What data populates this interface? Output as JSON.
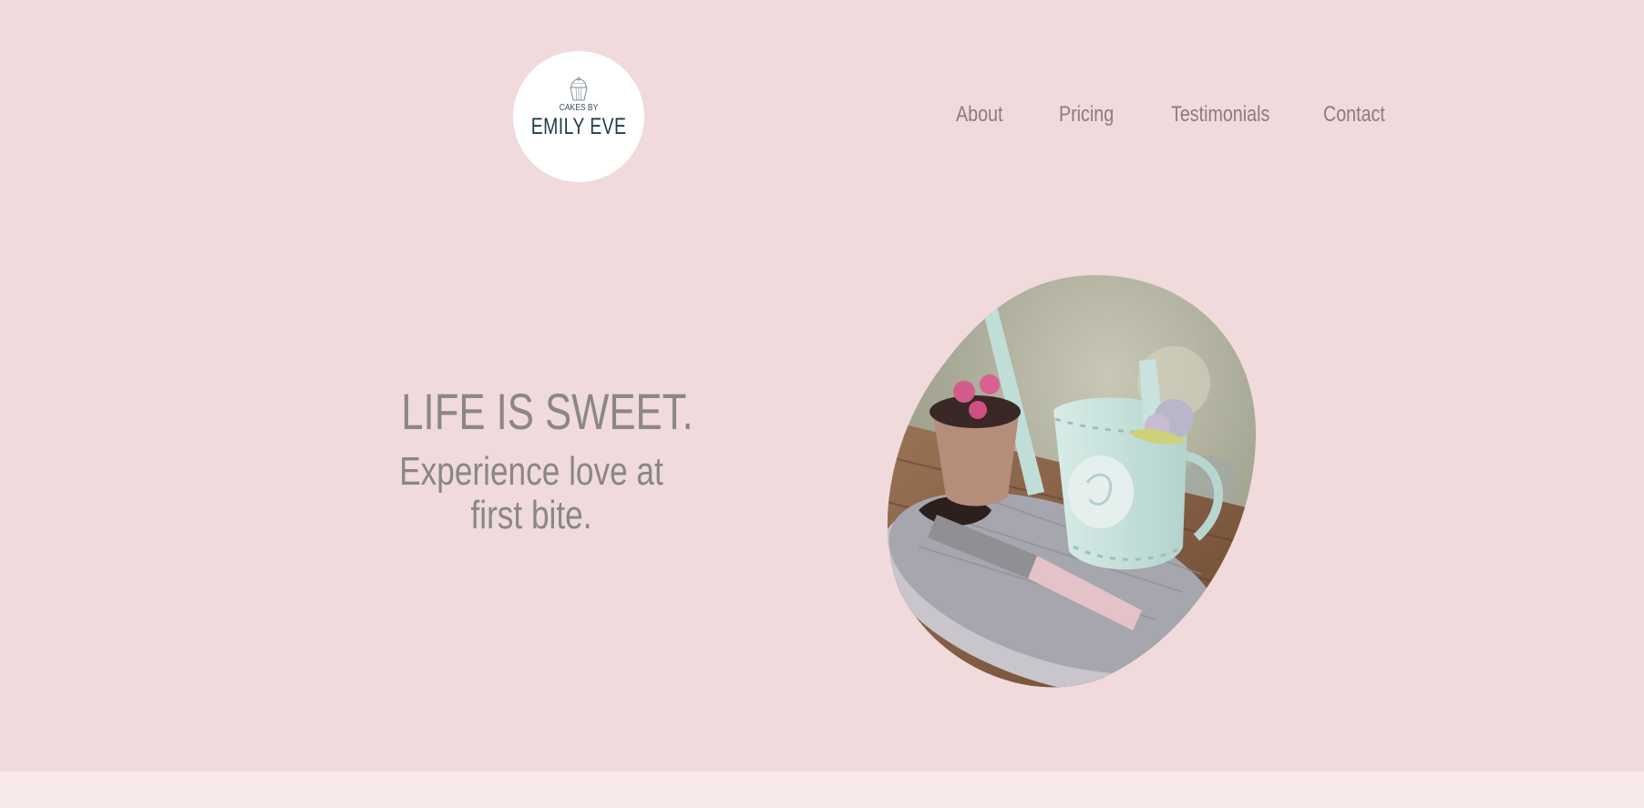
{
  "logo": {
    "small_text": "CAKES BY",
    "big_text": "EMILY EVE",
    "icon": "cupcake-icon"
  },
  "nav": {
    "items": [
      {
        "label": "About"
      },
      {
        "label": "Pricing"
      },
      {
        "label": "Testimonials"
      },
      {
        "label": "Contact"
      }
    ]
  },
  "hero": {
    "title": "LIFE IS SWEET.",
    "subtitle": "Experience love at first bite."
  },
  "colors": {
    "background": "#f0dadc",
    "footer_strip": "#f7e9ea",
    "nav_text": "#8a7d7f",
    "logo_text": "#1f3c4a",
    "headline_text": "#8a8787"
  }
}
